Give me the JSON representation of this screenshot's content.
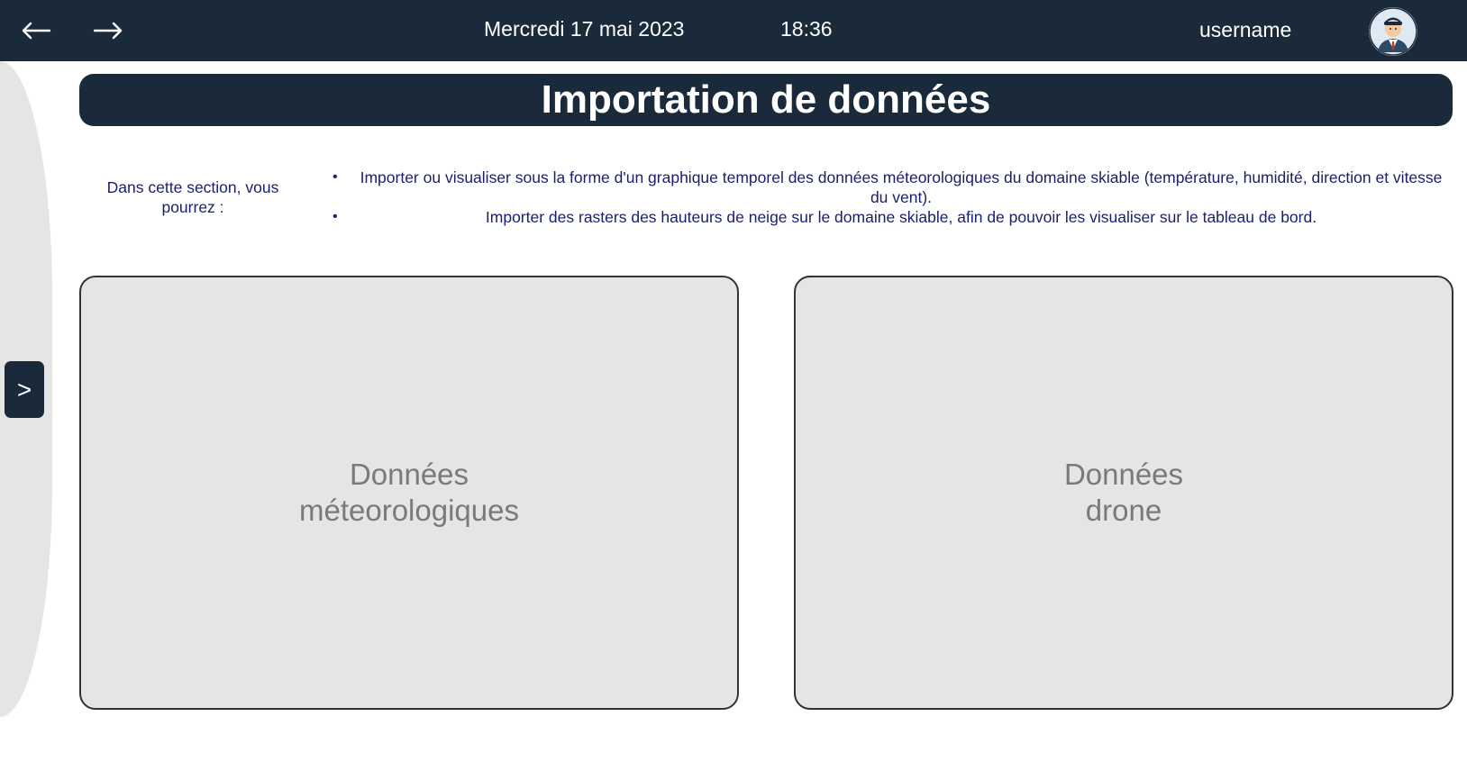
{
  "header": {
    "back_icon": "arrow-left-icon",
    "forward_icon": "arrow-right-icon",
    "date": "Mercredi 17 mai 2023",
    "time": "18:36",
    "username": "username",
    "avatar_icon": "user-avatar-icon"
  },
  "sidebar": {
    "toggle_label": ">"
  },
  "page": {
    "title": "Importation de données",
    "intro": "Dans cette section, vous pourrez :",
    "bullets": [
      "Importer ou visualiser sous la forme d'un graphique temporel des données méteorologiques du domaine skiable (température, humidité, direction et vitesse du vent).",
      "Importer des rasters des hauteurs de neige sur le domaine skiable, afin de pouvoir les visualiser sur le tableau de bord."
    ]
  },
  "cards": [
    {
      "label": "Données\nméteorologiques"
    },
    {
      "label": "Données\ndrone"
    }
  ],
  "colors": {
    "header_bg": "#1b2a3a",
    "text_blue": "#1b1f6b",
    "card_bg": "#e5e5e5"
  }
}
